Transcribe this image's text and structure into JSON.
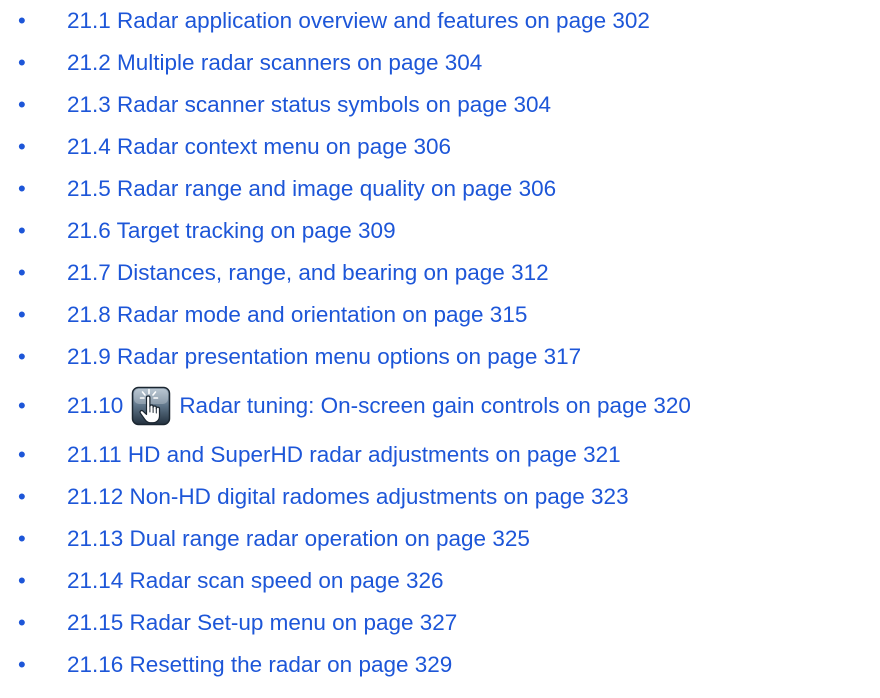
{
  "toc": {
    "items": [
      {
        "bullet": "•",
        "text": "21.1 Radar application overview and features on page 302"
      },
      {
        "bullet": "•",
        "text": "21.2 Multiple radar scanners on page 304"
      },
      {
        "bullet": "•",
        "text": "21.3 Radar scanner status symbols on page 304"
      },
      {
        "bullet": "•",
        "text": "21.4 Radar context menu on page 306"
      },
      {
        "bullet": "•",
        "text": "21.5 Radar range and image quality on page 306"
      },
      {
        "bullet": "•",
        "text": "21.6 Target tracking on page 309"
      },
      {
        "bullet": "•",
        "text": "21.7 Distances, range, and bearing on page 312"
      },
      {
        "bullet": "•",
        "text": "21.8 Radar mode and orientation on page 315"
      },
      {
        "bullet": "•",
        "text": "21.9 Radar presentation menu options on page 317"
      },
      {
        "bullet": "•",
        "number": "21.10",
        "icon": "touch-gain-icon",
        "text": "Radar tuning: On-screen gain controls on page 320"
      },
      {
        "bullet": "•",
        "text": "21.11 HD and SuperHD radar adjustments on page 321"
      },
      {
        "bullet": "•",
        "text": "21.12 Non-HD digital radomes adjustments on page 323"
      },
      {
        "bullet": "•",
        "text": "21.13 Dual range radar operation on page 325"
      },
      {
        "bullet": "•",
        "text": "21.14 Radar scan speed on page 326"
      },
      {
        "bullet": "•",
        "text": "21.15 Radar Set-up menu on page 327"
      },
      {
        "bullet": "•",
        "text": "21.16 Resetting the radar on page 329"
      }
    ]
  },
  "colors": {
    "link": "#1d56d8"
  }
}
